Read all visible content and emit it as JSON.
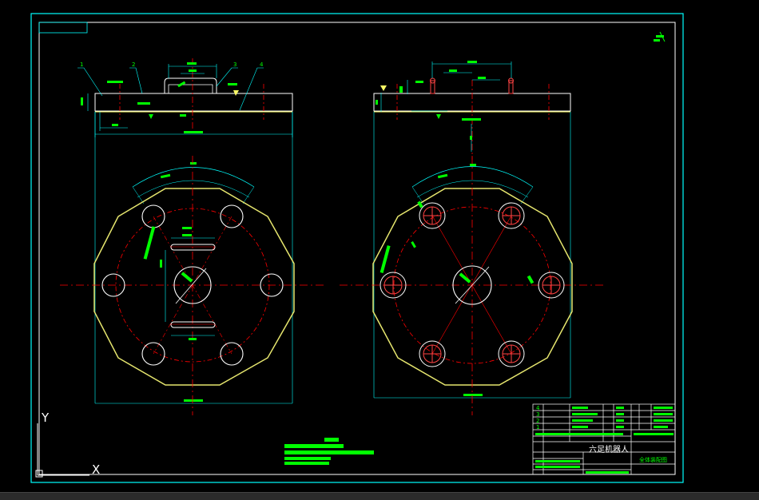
{
  "colors": {
    "background": "#000000",
    "frame": "#00ffff",
    "inner_frame": "#ffffff",
    "contour": "#ffff66",
    "centerline": "#ff0000",
    "holes": "#ffffff",
    "dimension_text": "#00ff00",
    "dimension_line": "#00ffff",
    "rays": "#ff0000"
  },
  "drawing": {
    "part_numbers": [
      "1",
      "2",
      "3",
      "4"
    ],
    "title_block": {
      "title": "六足机器人",
      "subtitle": "全体装配图",
      "row_numbers": [
        "4",
        "3",
        "2",
        "1"
      ]
    }
  },
  "ucs": {
    "y_label": "Y",
    "x_label": "X"
  }
}
